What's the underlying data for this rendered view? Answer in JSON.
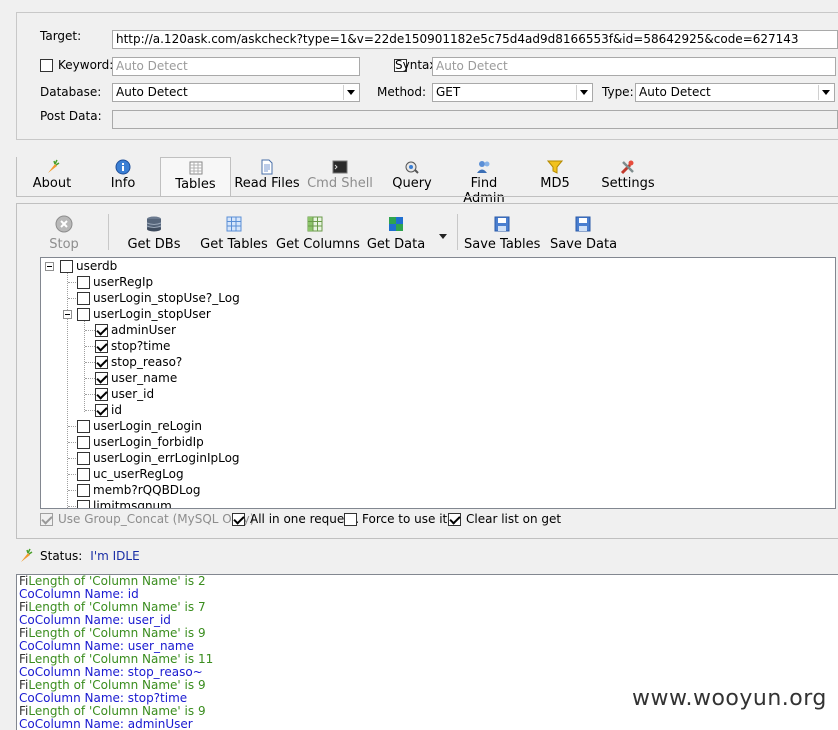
{
  "params": {
    "target_label": "Target:",
    "target_value": "http://a.120ask.com/askcheck?type=1&v=22de150901182e5c75d4ad9d8166553f&id=58642925&code=627143",
    "keyword_label": "Keyword:",
    "keyword_placeholder": "Auto Detect",
    "syntax_label": "Syntax:",
    "syntax_placeholder": "Auto Detect",
    "database_label": "Database:",
    "database_value": "Auto Detect",
    "method_label": "Method:",
    "method_value": "GET",
    "type_label": "Type:",
    "type_value": "Auto Detect",
    "postdata_label": "Post Data:"
  },
  "tabs": [
    {
      "label": "About",
      "icon": "carrot-icon"
    },
    {
      "label": "Info",
      "icon": "info-icon"
    },
    {
      "label": "Tables",
      "icon": "table-icon",
      "selected": true
    },
    {
      "label": "Read Files",
      "icon": "file-icon"
    },
    {
      "label": "Cmd Shell",
      "icon": "console-icon",
      "disabled": true
    },
    {
      "label": "Query",
      "icon": "query-icon"
    },
    {
      "label": "Find Admin",
      "icon": "users-icon"
    },
    {
      "label": "MD5",
      "icon": "funnel-icon"
    },
    {
      "label": "Settings",
      "icon": "tools-icon"
    }
  ],
  "toolbar": {
    "stop": "Stop",
    "get_dbs": "Get DBs",
    "get_tables": "Get Tables",
    "get_columns": "Get Columns",
    "get_data": "Get Data",
    "save_tables": "Save Tables",
    "save_data": "Save Data"
  },
  "tree": {
    "root": "userdb",
    "items": [
      {
        "label": "userRegIp"
      },
      {
        "label": "userLogin_stopUse?_Log"
      },
      {
        "label": "userLogin_stopUser"
      },
      {
        "label": "adminUser"
      },
      {
        "label": "stop?time"
      },
      {
        "label": "stop_reaso?"
      },
      {
        "label": "user_name"
      },
      {
        "label": "user_id"
      },
      {
        "label": "id"
      },
      {
        "label": "userLogin_reLogin"
      },
      {
        "label": "userLogin_forbidIp"
      },
      {
        "label": "userLogin_errLoginIpLog"
      },
      {
        "label": "uc_userRegLog"
      },
      {
        "label": "memb?rQQBDLog"
      },
      {
        "label": "limitmsgnum"
      }
    ]
  },
  "options": {
    "group_concat": "Use Group_Concat (MySQL Only)",
    "all_in_one": "All in one request.",
    "force_use": "Force to use it",
    "clear_list": "Clear list on get"
  },
  "status": {
    "label": "Status:",
    "value": "I'm IDLE"
  },
  "log": [
    {
      "pre": "Fi",
      "text": "Length of 'Column Name' is 2",
      "color": "green"
    },
    {
      "pre": "Co",
      "text": "Column Name: id",
      "color": "blue"
    },
    {
      "pre": "Fi",
      "text": "Length of 'Column Name' is 7",
      "color": "green"
    },
    {
      "pre": "Co",
      "text": "Column Name: user_id",
      "color": "blue"
    },
    {
      "pre": "Fi",
      "text": "Length of 'Column Name' is 9",
      "color": "green"
    },
    {
      "pre": "Co",
      "text": "Column Name: user_name",
      "color": "blue"
    },
    {
      "pre": "Fi",
      "text": "Length of 'Column Name' is 11",
      "color": "green"
    },
    {
      "pre": "Co",
      "text": "Column Name: stop_reaso~",
      "color": "blue"
    },
    {
      "pre": "Fi",
      "text": "Length of 'Column Name' is 9",
      "color": "green"
    },
    {
      "pre": "Co",
      "text": "Column Name: stop?time",
      "color": "blue"
    },
    {
      "pre": "Fi",
      "text": "Length of 'Column Name' is 9",
      "color": "green"
    },
    {
      "pre": "Co",
      "text": "Column Name: adminUser",
      "color": "blue"
    }
  ],
  "watermark": "www.wooyun.org"
}
